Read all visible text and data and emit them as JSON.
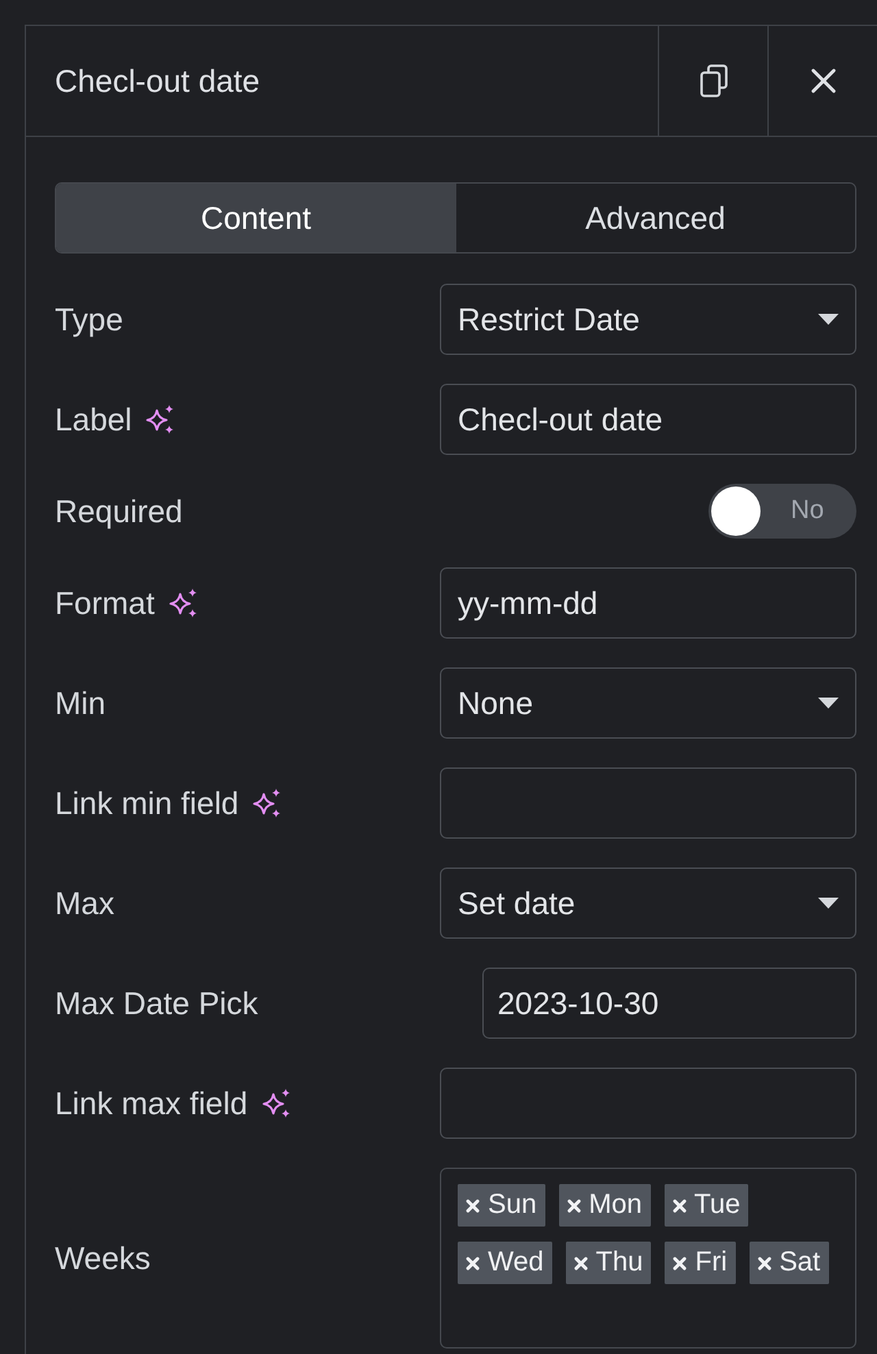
{
  "panel": {
    "title": "Checl-out date"
  },
  "tabs": [
    {
      "label": "Content",
      "selected": true
    },
    {
      "label": "Advanced",
      "selected": false
    }
  ],
  "controls": [
    {
      "kind": "select",
      "label": "Type",
      "sparkle": false,
      "value": "Restrict Date"
    },
    {
      "kind": "text",
      "label": "Label",
      "sparkle": true,
      "value": "Checl-out date"
    },
    {
      "kind": "switch",
      "label": "Required",
      "sparkle": false,
      "on": false,
      "switch_text": "No"
    },
    {
      "kind": "text",
      "label": "Format",
      "sparkle": true,
      "value": "yy-mm-dd"
    },
    {
      "kind": "select",
      "label": "Min",
      "sparkle": false,
      "value": "None"
    },
    {
      "kind": "text",
      "label": "Link min field",
      "sparkle": true
    },
    {
      "kind": "select",
      "label": "Max",
      "sparkle": false,
      "value": "Set date"
    },
    {
      "kind": "date",
      "label": "Max Date Pick",
      "sparkle": false,
      "value": "2023-10-30"
    },
    {
      "kind": "text",
      "label": "Link max field",
      "sparkle": true
    },
    {
      "kind": "tags",
      "label": "Weeks",
      "sparkle": false,
      "tags": [
        "Sun",
        "Mon",
        "Tue",
        "Wed",
        "Thu",
        "Fri",
        "Sat"
      ]
    }
  ]
}
